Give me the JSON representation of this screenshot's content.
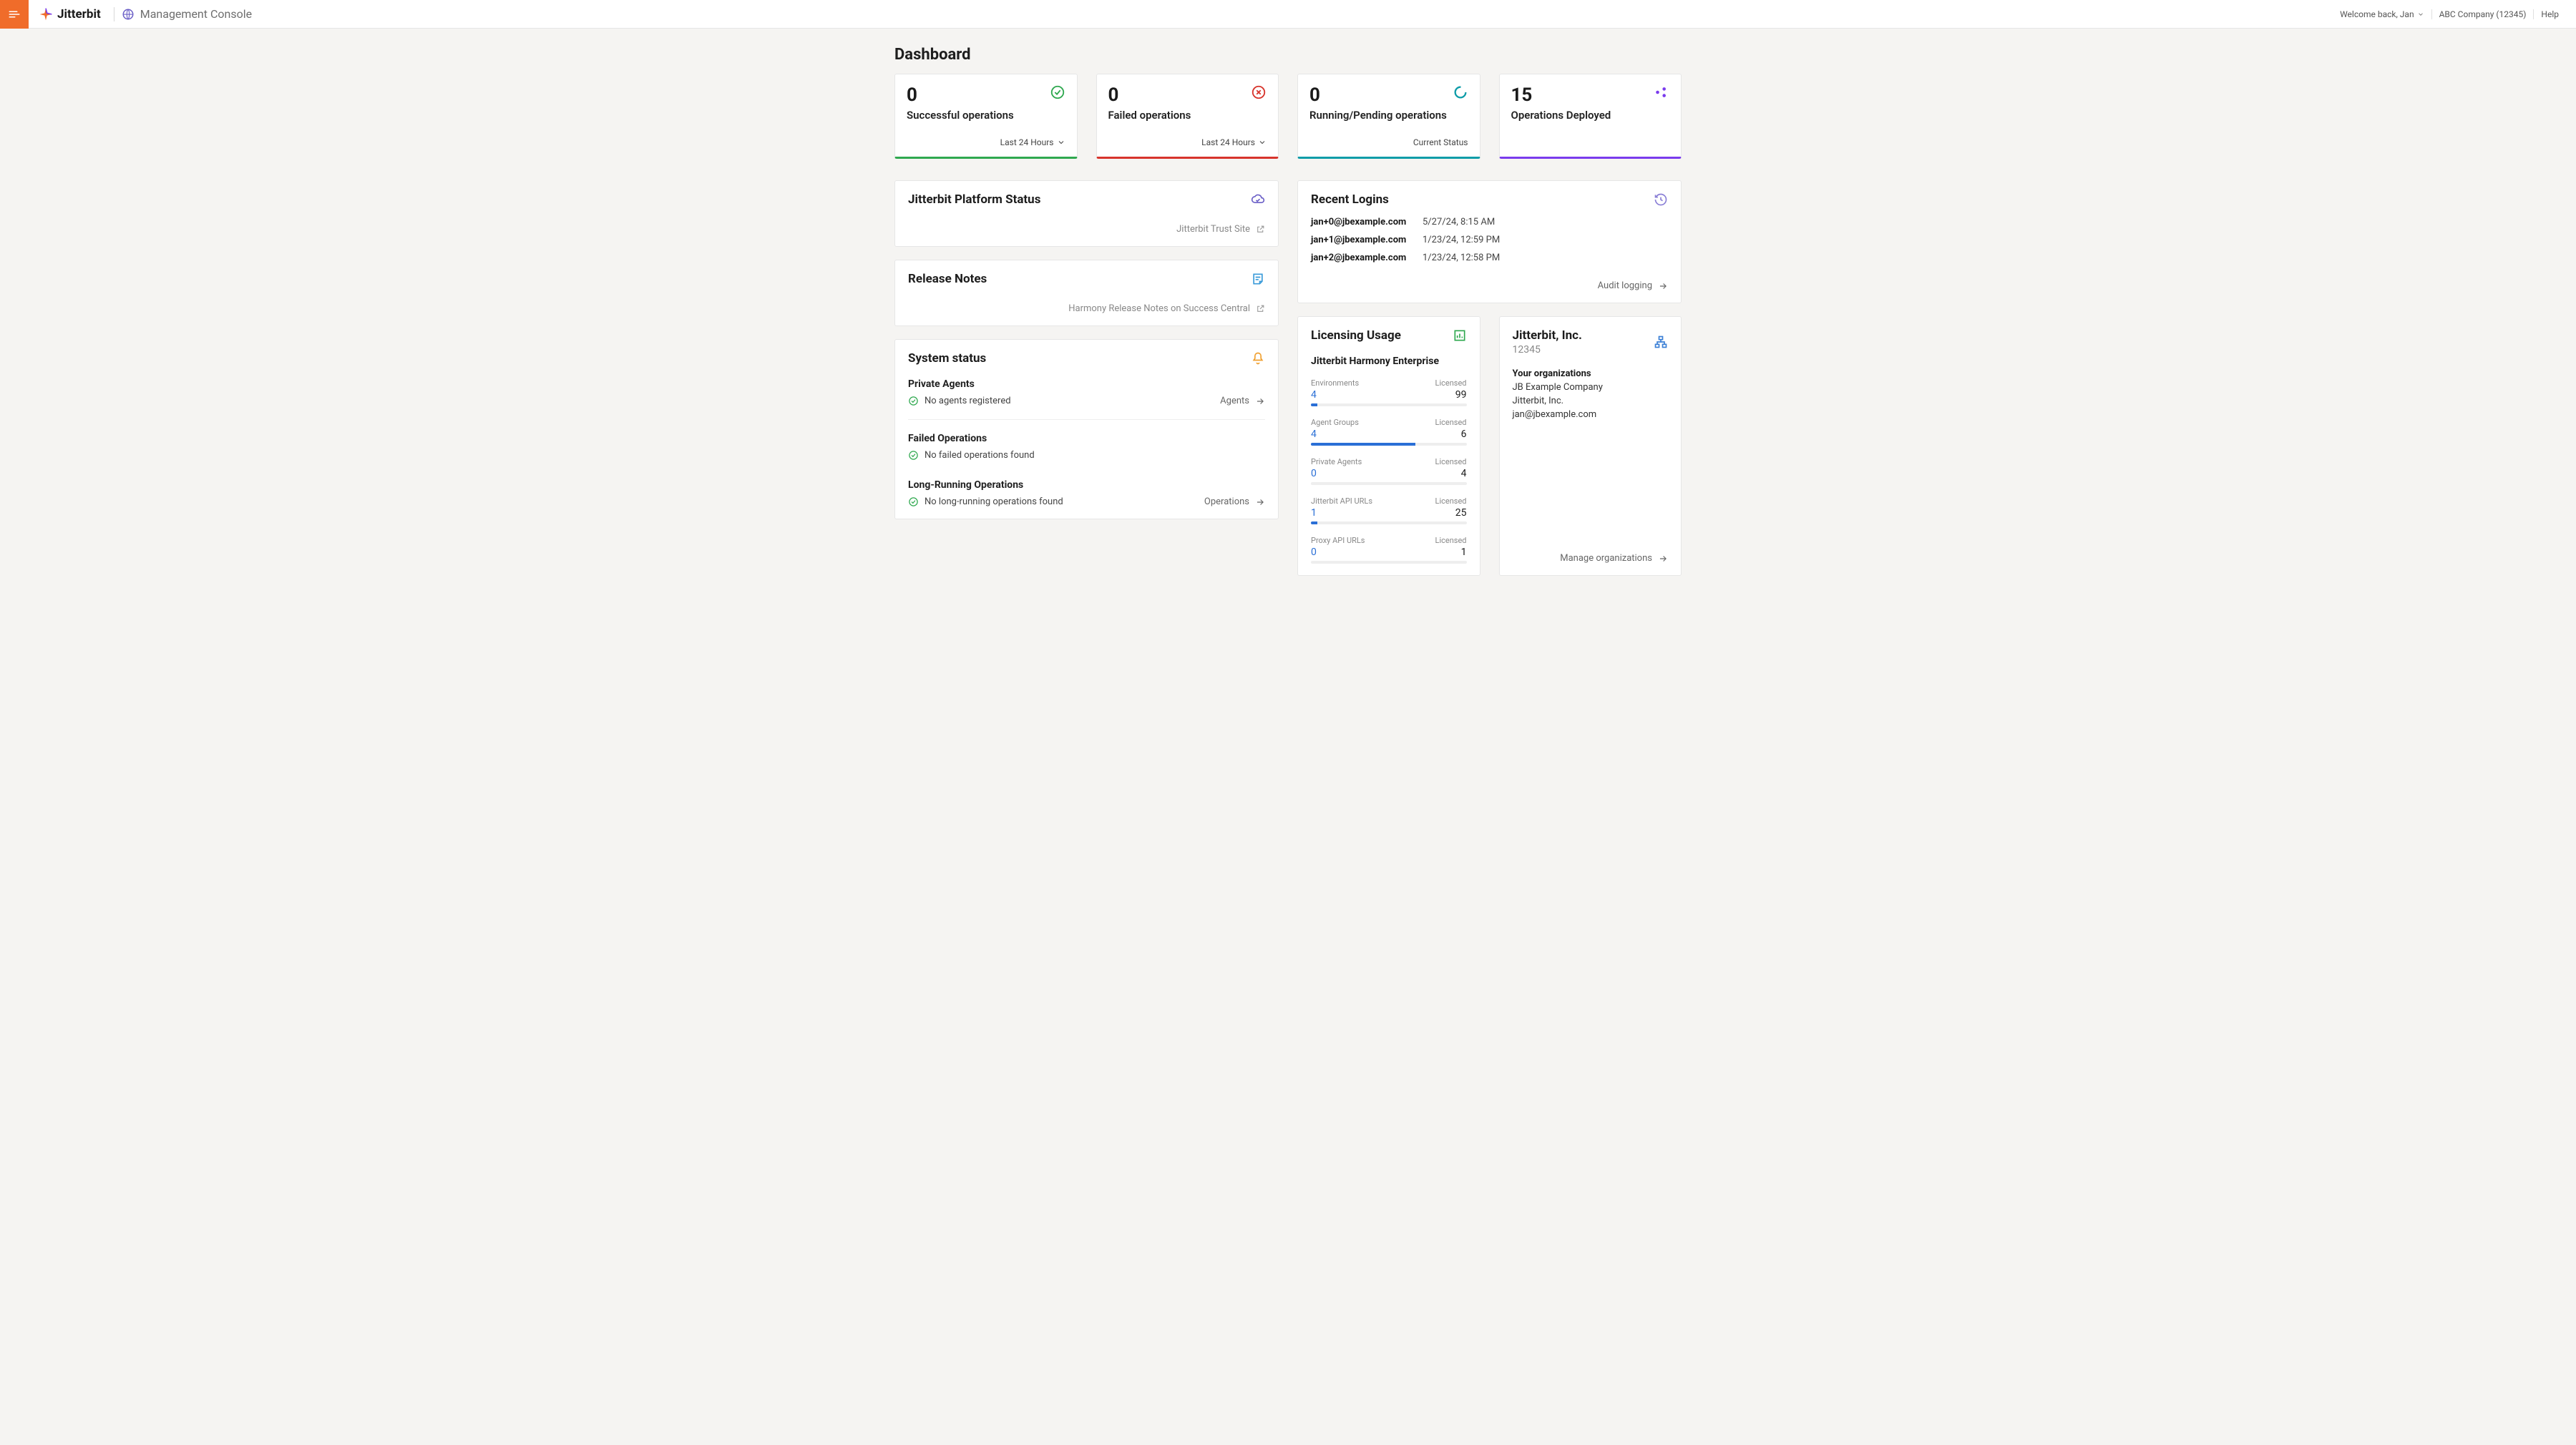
{
  "header": {
    "brand": "Jitterbit",
    "app_title": "Management Console",
    "welcome": "Welcome back, Jan",
    "org": "ABC Company (12345)",
    "help": "Help"
  },
  "page_title": "Dashboard",
  "stats": {
    "successful": {
      "value": "0",
      "label": "Successful operations",
      "footer": "Last 24 Hours"
    },
    "failed": {
      "value": "0",
      "label": "Failed operations",
      "footer": "Last 24 Hours"
    },
    "running": {
      "value": "0",
      "label": "Running/Pending operations",
      "footer": "Current Status"
    },
    "deployed": {
      "value": "15",
      "label": "Operations Deployed"
    }
  },
  "platform_status": {
    "title": "Jitterbit Platform Status",
    "link": "Jitterbit Trust Site"
  },
  "release_notes": {
    "title": "Release Notes",
    "link": "Harmony Release Notes on Success Central"
  },
  "system_status": {
    "title": "System status",
    "private_agents": {
      "title": "Private Agents",
      "status": "No agents registered",
      "link": "Agents"
    },
    "failed_ops": {
      "title": "Failed Operations",
      "status": "No failed operations found"
    },
    "long_running": {
      "title": "Long-Running Operations",
      "status": "No long-running operations found",
      "link": "Operations"
    }
  },
  "recent_logins": {
    "title": "Recent Logins",
    "rows": [
      {
        "user": "jan+0@jbexample.com",
        "time": "5/27/24, 8:15 AM"
      },
      {
        "user": "jan+1@jbexample.com",
        "time": "1/23/24, 12:59 PM"
      },
      {
        "user": "jan+2@jbexample.com",
        "time": "1/23/24, 12:58 PM"
      }
    ],
    "link": "Audit logging"
  },
  "licensing": {
    "title": "Licensing Usage",
    "product": "Jitterbit Harmony Enterprise",
    "licensed_label": "Licensed",
    "items": [
      {
        "name": "Environments",
        "used": "4",
        "licensed": "99",
        "pct": 4
      },
      {
        "name": "Agent Groups",
        "used": "4",
        "licensed": "6",
        "pct": 67
      },
      {
        "name": "Private Agents",
        "used": "0",
        "licensed": "4",
        "pct": 0
      },
      {
        "name": "Jitterbit API URLs",
        "used": "1",
        "licensed": "25",
        "pct": 4
      },
      {
        "name": "Proxy API URLs",
        "used": "0",
        "licensed": "1",
        "pct": 0
      }
    ]
  },
  "org_card": {
    "title": "Jitterbit, Inc.",
    "id": "12345",
    "your_orgs_label": "Your organizations",
    "orgs": [
      "JB Example Company",
      "Jitterbit, Inc."
    ],
    "email": "jan@jbexample.com",
    "link": "Manage organizations"
  }
}
